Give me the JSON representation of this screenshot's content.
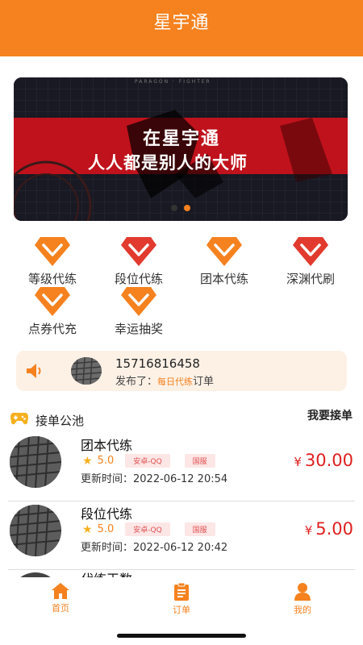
{
  "header": {
    "title": "星宇通"
  },
  "banner": {
    "caption": "PARAGON · FIGHTER",
    "line1": "在星宇通",
    "line2": "人人都是别人的大师",
    "dots": 2,
    "active_dot": 2
  },
  "services": [
    {
      "label": "等级代练",
      "icon": "orange-chevron-gem-icon"
    },
    {
      "label": "段位代练",
      "icon": "red-gem-icon"
    },
    {
      "label": "团本代练",
      "icon": "orange-chevron-gem-icon"
    },
    {
      "label": "深渊代刷",
      "icon": "red-gem-icon"
    },
    {
      "label": "点券代充",
      "icon": "orange-chevron-gem-icon"
    },
    {
      "label": "幸运抽奖",
      "icon": "orange-chevron-gem-icon"
    }
  ],
  "notice": {
    "phone": "15716816458",
    "prefix": "发布了：",
    "tag": "每日代练",
    "suffix": "订单"
  },
  "pool": {
    "title": "接单公池",
    "action": "我要接单"
  },
  "orders": [
    {
      "name": "团本代练",
      "rating": "5.0",
      "platform": "安卓-QQ",
      "server": "国服",
      "time": "更新时间：2022-06-12 20:54",
      "currency": "¥",
      "price": "30.00"
    },
    {
      "name": "段位代练",
      "rating": "5.0",
      "platform": "安卓-QQ",
      "server": "国服",
      "time": "更新时间：2022-06-12 20:42",
      "currency": "¥",
      "price": "5.00"
    }
  ],
  "peek_order": {
    "name": "代练王数"
  },
  "tabs": [
    {
      "label": "首页",
      "icon": "home-icon"
    },
    {
      "label": "订单",
      "icon": "clipboard-icon"
    },
    {
      "label": "我的",
      "icon": "user-icon"
    }
  ],
  "colors": {
    "accent": "#f5821f",
    "price": "#e02020",
    "gem_red": "#e23a2e",
    "notice_bg": "#fdf1e6"
  }
}
